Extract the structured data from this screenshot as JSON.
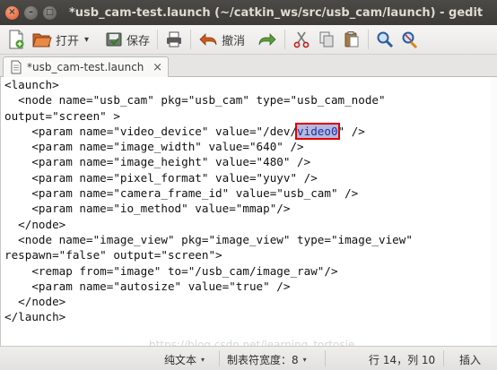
{
  "window": {
    "title": "*usb_cam-test.launch (~/catkin_ws/src/usb_cam/launch) - gedit",
    "close_glyph": "×",
    "min_glyph": "–",
    "max_glyph": "□"
  },
  "toolbar": {
    "open_label": "打开",
    "open_arrow": "▾",
    "save_label": "保存",
    "undo_label": "撤消"
  },
  "tab": {
    "label": "*usb_cam-test.launch",
    "close_glyph": "×"
  },
  "editor": {
    "lines": [
      "<launch>",
      "  <node name=\"usb_cam\" pkg=\"usb_cam\" type=\"usb_cam_node\"",
      "output=\"screen\" >",
      "    <param name=\"video_device\" value=\"/dev/",
      "    <param name=\"image_width\" value=\"640\" />",
      "    <param name=\"image_height\" value=\"480\" />",
      "    <param name=\"pixel_format\" value=\"yuyv\" />",
      "    <param name=\"camera_frame_id\" value=\"usb_cam\" />",
      "    <param name=\"io_method\" value=\"mmap\"/>",
      "  </node>",
      "  <node name=\"image_view\" pkg=\"image_view\" type=\"image_view\"",
      "respawn=\"false\" output=\"screen\">",
      "    <remap from=\"image\" to=\"/usb_cam/image_raw\"/>",
      "    <param name=\"autosize\" value=\"true\" />",
      "  </node>",
      "</launch>"
    ],
    "highlighted_word": "video0",
    "line4_suffix": "\" />",
    "watermark": "https://blog.csdn.net/learning_tortosie"
  },
  "statusbar": {
    "language": "纯文本",
    "tab_width": "制表符宽度：8",
    "position": "行 14，列 10",
    "mode": "插入",
    "dropdown_glyph": "▾"
  },
  "colors": {
    "titlebar": "#3c3b37",
    "close_button": "#e2572d",
    "selection": "#b6b9de",
    "highlight_border": "#e00000"
  }
}
